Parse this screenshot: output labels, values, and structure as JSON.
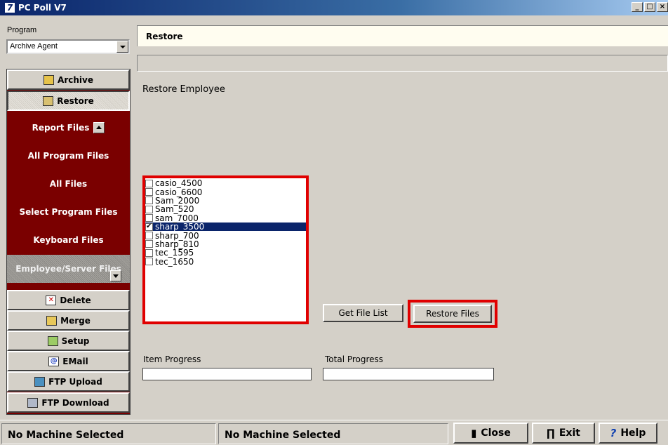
{
  "window": {
    "title": "PC Poll V7",
    "minimize": "_",
    "maximize": "□",
    "close": "×"
  },
  "program": {
    "label": "Program",
    "selected": "Archive Agent"
  },
  "nav": {
    "archive": "Archive",
    "restore": "Restore",
    "sub_items": [
      "Report Files",
      "All Program Files",
      "All Files",
      "Select Program Files",
      "Keyboard Files",
      "Employee/Server Files"
    ],
    "delete": "Delete",
    "merge": "Merge",
    "setup": "Setup",
    "email": "EMail",
    "ftp_upload": "FTP Upload",
    "ftp_download": "FTP Download"
  },
  "main": {
    "header": "Restore",
    "section_title": "Restore Employee",
    "files": [
      {
        "name": "casio_4500",
        "checked": false
      },
      {
        "name": "casio_6600",
        "checked": false
      },
      {
        "name": "Sam_2000",
        "checked": false
      },
      {
        "name": "Sam_520",
        "checked": false
      },
      {
        "name": "sam_7000",
        "checked": false
      },
      {
        "name": "sharp_3500",
        "checked": true,
        "selected": true
      },
      {
        "name": "sharp_700",
        "checked": false
      },
      {
        "name": "sharp_810",
        "checked": false
      },
      {
        "name": "tec_1595",
        "checked": false
      },
      {
        "name": "tec_1650",
        "checked": false
      }
    ],
    "get_file_list": "Get File List",
    "restore_files": "Restore Files",
    "item_progress_label": "Item Progress",
    "total_progress_label": "Total Progress",
    "item_progress": 0,
    "total_progress": 0
  },
  "status": {
    "left": "No Machine Selected",
    "middle": "No Machine Selected",
    "close": "Close",
    "exit": "Exit",
    "help": "Help"
  },
  "colors": {
    "nav_panel": "#7a0000",
    "highlight_frame": "#e00000",
    "selection": "#0a246a"
  }
}
